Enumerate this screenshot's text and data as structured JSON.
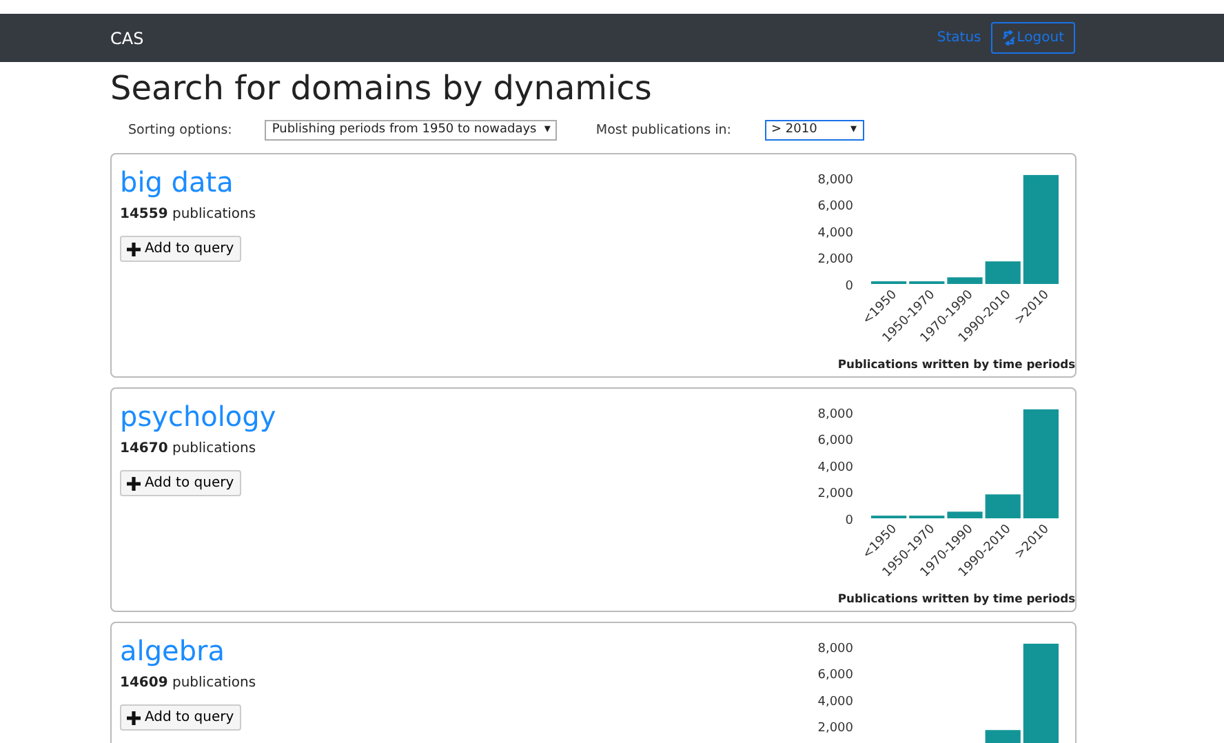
{
  "navbar": {
    "brand": "CAS",
    "links": [
      {
        "label": "Status"
      }
    ],
    "logout": {
      "label": "Logout"
    }
  },
  "title": "Search for domains by dynamics",
  "filters": [
    {
      "label": "Sorting options:",
      "value": "Publishing periods from 1950 to nowadays",
      "caret": "▾",
      "focused": false
    },
    {
      "label": "Most publications in:",
      "value": "> 2010",
      "caret": "▾",
      "focused": true
    }
  ],
  "domains": [
    {
      "name": "big data",
      "count": "14559",
      "count_suffix": "publications",
      "button": "Add to query",
      "chart_data": {
        "type": "bar",
        "title": "Publications written by time periods",
        "categories": [
          "<1950",
          "1950-1970",
          "1970-1990",
          "1990-2010",
          ">2010"
        ],
        "values": [
          200,
          200,
          500,
          1700,
          8200
        ],
        "ylim": [
          0,
          8300
        ],
        "yticks": [
          {
            "value": 0,
            "label": "0"
          },
          {
            "value": 2000,
            "label": "2,000"
          },
          {
            "value": 4000,
            "label": "4,000"
          },
          {
            "value": 6000,
            "label": "6,000"
          },
          {
            "value": 8000,
            "label": "8,000"
          }
        ]
      }
    },
    {
      "name": "psychology",
      "count": "14670",
      "count_suffix": "publications",
      "button": "Add to query",
      "chart_data": {
        "type": "bar",
        "title": "Publications written by time periods",
        "categories": [
          "<1950",
          "1950-1970",
          "1970-1990",
          "1990-2010",
          ">2010"
        ],
        "values": [
          200,
          200,
          500,
          1800,
          8200
        ],
        "ylim": [
          0,
          8300
        ],
        "yticks": [
          {
            "value": 0,
            "label": "0"
          },
          {
            "value": 2000,
            "label": "2,000"
          },
          {
            "value": 4000,
            "label": "4,000"
          },
          {
            "value": 6000,
            "label": "6,000"
          },
          {
            "value": 8000,
            "label": "8,000"
          }
        ]
      }
    },
    {
      "name": "algebra",
      "count": "14609",
      "count_suffix": "publications",
      "button": "Add to query",
      "chart_data": {
        "type": "bar",
        "values": [
          null,
          null,
          null,
          1700,
          8200
        ],
        "ylim": [
          0,
          8300
        ],
        "yticks": [
          {
            "value": 2000,
            "label": "2,000"
          },
          {
            "value": 4000,
            "label": "4,000"
          },
          {
            "value": 6000,
            "label": "6,000"
          },
          {
            "value": 8000,
            "label": "8,000"
          }
        ]
      }
    }
  ]
}
